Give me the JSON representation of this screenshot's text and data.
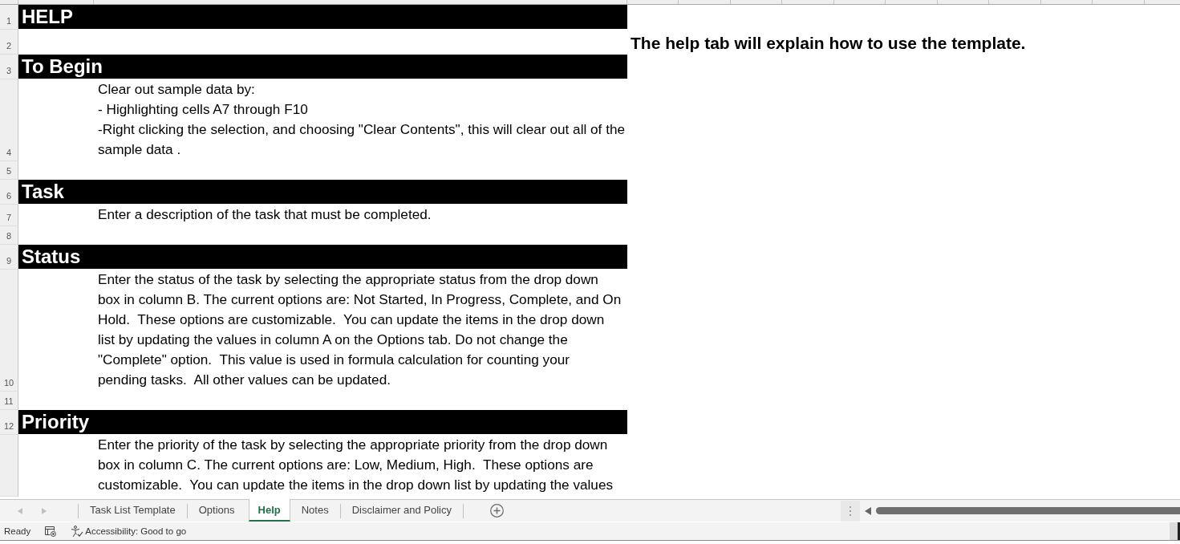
{
  "sheet": {
    "rows": [
      {
        "number": "1",
        "kind": "heading",
        "text": "HELP"
      },
      {
        "number": "2",
        "kind": "note",
        "text": "The help tab will explain how to use the template."
      },
      {
        "number": "3",
        "kind": "heading",
        "text": "To Begin"
      },
      {
        "number": "4",
        "kind": "body",
        "text": "Clear out sample data by:\n- Highlighting cells A7 through F10\n-Right clicking the selection, and choosing \"Clear Contents\", this will clear out all of the\nsample data ."
      },
      {
        "number": "5",
        "kind": "blank"
      },
      {
        "number": "6",
        "kind": "heading",
        "text": "Task"
      },
      {
        "number": "7",
        "kind": "body",
        "text": "Enter a description of the task that must be completed."
      },
      {
        "number": "8",
        "kind": "blank"
      },
      {
        "number": "9",
        "kind": "heading",
        "text": "Status"
      },
      {
        "number": "10",
        "kind": "body",
        "text": "Enter the status of the task by selecting the appropriate status from the drop down\nbox in column B. The current options are: Not Started, In Progress, Complete, and On\nHold.  These options are customizable.  You can update the items in the drop down\nlist by updating the values in column A on the Options tab. Do not change the\n\"Complete\" option.  This value is used in formula calculation for counting your\npending tasks.  All other values can be updated."
      },
      {
        "number": "11",
        "kind": "blank"
      },
      {
        "number": "12",
        "kind": "heading",
        "text": "Priority"
      },
      {
        "kind": "body",
        "text": "Enter the priority of the task by selecting the appropriate priority from the drop down\nbox in column C. The current options are: Low, Medium, High.  These options are\ncustomizable.  You can update the items in the drop down list by updating the values"
      }
    ]
  },
  "sheet_tabs": [
    {
      "label": "Task List Template",
      "selected": false
    },
    {
      "label": "Options",
      "selected": false
    },
    {
      "label": "Help",
      "selected": true
    },
    {
      "label": "Notes",
      "selected": false
    },
    {
      "label": "Disclaimer and Policy",
      "selected": false
    }
  ],
  "status_bar": {
    "mode": "Ready",
    "accessibility": "Accessibility: Good to go"
  }
}
